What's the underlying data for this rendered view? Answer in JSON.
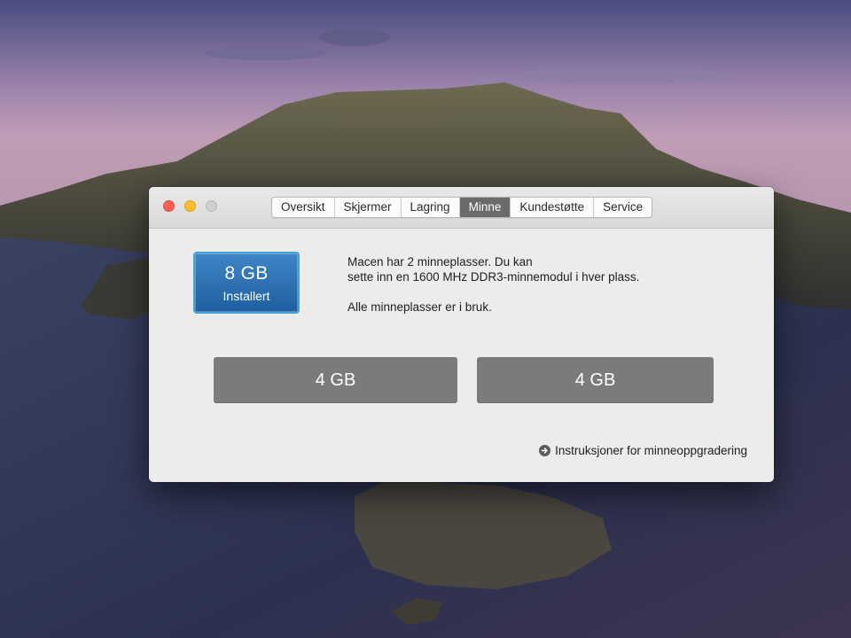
{
  "window": {
    "tabs": [
      {
        "label": "Oversikt",
        "active": false
      },
      {
        "label": "Skjermer",
        "active": false
      },
      {
        "label": "Lagring",
        "active": false
      },
      {
        "label": "Minne",
        "active": true
      },
      {
        "label": "Kundestøtte",
        "active": false
      },
      {
        "label": "Service",
        "active": false
      }
    ]
  },
  "memory": {
    "installed_size": "8 GB",
    "installed_label": "Installert",
    "info_line1": "Macen har 2 minneplasser. Du kan",
    "info_line2": "sette inn en 1600 MHz DDR3-minnemodul i hver plass.",
    "info_line3": "Alle minneplasser er i bruk.",
    "slots": [
      {
        "size": "4 GB"
      },
      {
        "size": "4 GB"
      }
    ],
    "upgrade_link": "Instruksjoner for minneoppgradering"
  },
  "colors": {
    "close": "#fc5f57",
    "minimize": "#fdbc2e",
    "zoom_disabled": "#cfcfcf",
    "active_tab": "#6b6b6b",
    "badge": "#2f74b5",
    "slot": "#7b7b7b"
  },
  "icons": {
    "link_icon": "arrow-right-circle-icon"
  }
}
